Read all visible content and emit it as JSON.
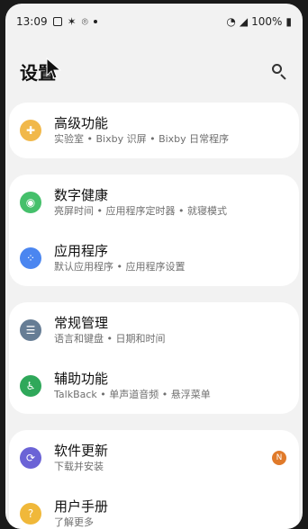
{
  "status": {
    "time": "13:09",
    "battery": "100%"
  },
  "header": {
    "title": "设置"
  },
  "colors": {
    "advanced": "#f1b84a",
    "wellbeing": "#45c06b",
    "apps": "#4b86f0",
    "general": "#667d95",
    "accessibility": "#2fa85a",
    "update": "#6b63d6",
    "manual": "#f0b83a",
    "badge": "#e07a2a"
  },
  "items": [
    {
      "title": "高级功能",
      "subtitle": "实验室 • Bixby 识屏 • Bixby 日常程序",
      "icon": "advanced-features-icon"
    },
    {
      "title": "数字健康",
      "subtitle": "亮屏时间 • 应用程序定时器 • 就寝模式",
      "icon": "digital-wellbeing-icon"
    },
    {
      "title": "应用程序",
      "subtitle": "默认应用程序 • 应用程序设置",
      "icon": "apps-icon"
    },
    {
      "title": "常规管理",
      "subtitle": "语言和键盘 • 日期和时间",
      "icon": "general-management-icon"
    },
    {
      "title": "辅助功能",
      "subtitle": "TalkBack • 单声道音频 • 悬浮菜单",
      "icon": "accessibility-icon"
    },
    {
      "title": "软件更新",
      "subtitle": "下载并安装",
      "icon": "software-update-icon",
      "badge": "N"
    },
    {
      "title": "用户手册",
      "subtitle": "了解更多",
      "icon": "user-manual-icon"
    }
  ]
}
